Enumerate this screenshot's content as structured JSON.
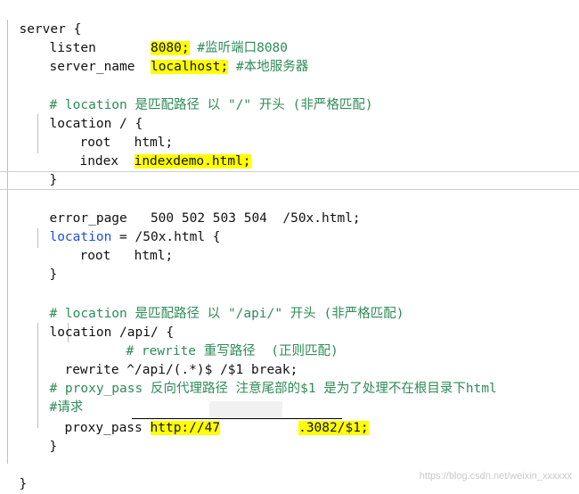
{
  "code": {
    "l1_kw": "server {",
    "l2_key": "listen",
    "l2_val": "8080",
    "l2_semi": ";",
    "l2_comment": " #监听端口8080",
    "l3_key": "server_name",
    "l3_val": "localhost;",
    "l3_comment": " #本地服务器",
    "l5_comment": "# location 是匹配路径 以 \"/\" 开头 (非严格匹配)",
    "l6": "location / {",
    "l7_key": "root",
    "l7_val": "html;",
    "l8_key": "index",
    "l8_val": "indexdemo.html;",
    "l9": "}",
    "l11": "error_page   500 502 503 504  /50x.html;",
    "l12_kw": "location",
    "l12_rest": " = /50x.html {",
    "l13_key": "root",
    "l13_val": "html;",
    "l14": "}",
    "l16_comment": "# location 是匹配路径 以 \"/api/\" 开头 (非严格匹配)",
    "l17": "location /api/ {",
    "l18_comment": "# rewrite 重写路径  (正则匹配)",
    "l19": "rewrite ^/api/(.*)$ /$1 break;",
    "l20_comment": "# proxy_pass 反向代理路径 注意尾部的$1 是为了处理不在根目录下html",
    "l21_comment": "#请求",
    "l22_key": "proxy_pass",
    "l22_url_a": "http://47",
    "l22_url_b": ".3082/$1;",
    "l23": "}",
    "l25": "}"
  },
  "watermark": "https://blog.csdn.net/weixin_xxxxxx",
  "colors": {
    "comment": "#2e8b57",
    "keyword": "#1f4fd6",
    "highlight": "#ffff00"
  }
}
